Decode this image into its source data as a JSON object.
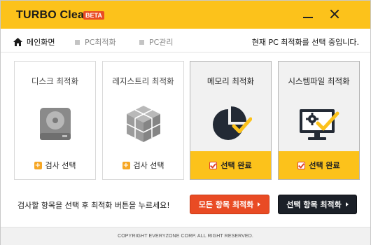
{
  "app": {
    "title": "TURBO Cleaner",
    "badge": "BETA"
  },
  "nav": {
    "items": [
      {
        "label": "메인화면",
        "icon": "home-icon",
        "active": true
      },
      {
        "label": "PC최적화",
        "icon": "square-icon",
        "active": false
      },
      {
        "label": "PC관리",
        "icon": "square-icon",
        "active": false
      }
    ],
    "status": "현재 PC 최적화를 선택 중입니다."
  },
  "cards": [
    {
      "title": "디스크 최적화",
      "icon": "hard-disk-icon",
      "action_label": "검사 선택",
      "selected": false
    },
    {
      "title": "레지스트리 최적화",
      "icon": "registry-cubes-icon",
      "action_label": "검사 선택",
      "selected": false
    },
    {
      "title": "메모리 최적화",
      "icon": "memory-pie-check-icon",
      "action_label": "선택 완료",
      "selected": true
    },
    {
      "title": "시스템파일 최적화",
      "icon": "monitor-gear-check-icon",
      "action_label": "선택 완료",
      "selected": true
    }
  ],
  "instruction": "검사할 항목을 선택 후 최적화 버튼을 누르세요!",
  "buttons": {
    "optimize_all": "모든 항목 최적화",
    "optimize_selected": "선택 항목 최적화"
  },
  "footer": "COPYRIGHT EVERYZONE CORP. ALL RIGHT RESERVED.",
  "colors": {
    "accent": "#fcc21b",
    "primary_button": "#e94b24",
    "dark_button": "#1b2028",
    "check": "#e0432a",
    "plus": "#f6a623"
  }
}
